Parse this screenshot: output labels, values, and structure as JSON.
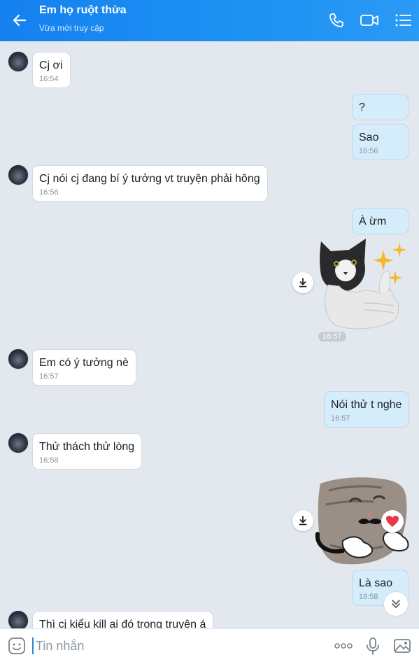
{
  "header": {
    "title": "Em họ ruột thừa",
    "subtitle": "Vừa mới truy cập"
  },
  "messages": [
    {
      "sender": "them",
      "text": "Cj ơi",
      "time": "16:54"
    },
    {
      "sender": "me",
      "text": "?",
      "time": ""
    },
    {
      "sender": "me",
      "text": "Sao",
      "time": "16:56"
    },
    {
      "sender": "them",
      "text": "Cj nói cj đang bí ý tưởng vt truyện phải hông",
      "time": "16:56"
    },
    {
      "sender": "me",
      "text": "À ừm",
      "time": ""
    },
    {
      "sender": "me",
      "type": "sticker",
      "name": "thumbs-up-cat-sticker",
      "time": "16:57"
    },
    {
      "sender": "them",
      "text": "Em có ý tưởng nè",
      "time": "16:57"
    },
    {
      "sender": "me",
      "text": "Nói thử t nghe",
      "time": "16:57"
    },
    {
      "sender": "them",
      "text": "Thử thách thử lòng",
      "time": "16:58"
    },
    {
      "sender": "me",
      "type": "sticker",
      "name": "mustache-cat-sticker",
      "reaction": "heart"
    },
    {
      "sender": "me",
      "text": "Là sao",
      "time": "16:58"
    },
    {
      "sender": "them",
      "text": "Thì cj kiểu kill ai đó trong truyện á",
      "time": ""
    }
  ],
  "input": {
    "placeholder": "Tin nhắn"
  }
}
